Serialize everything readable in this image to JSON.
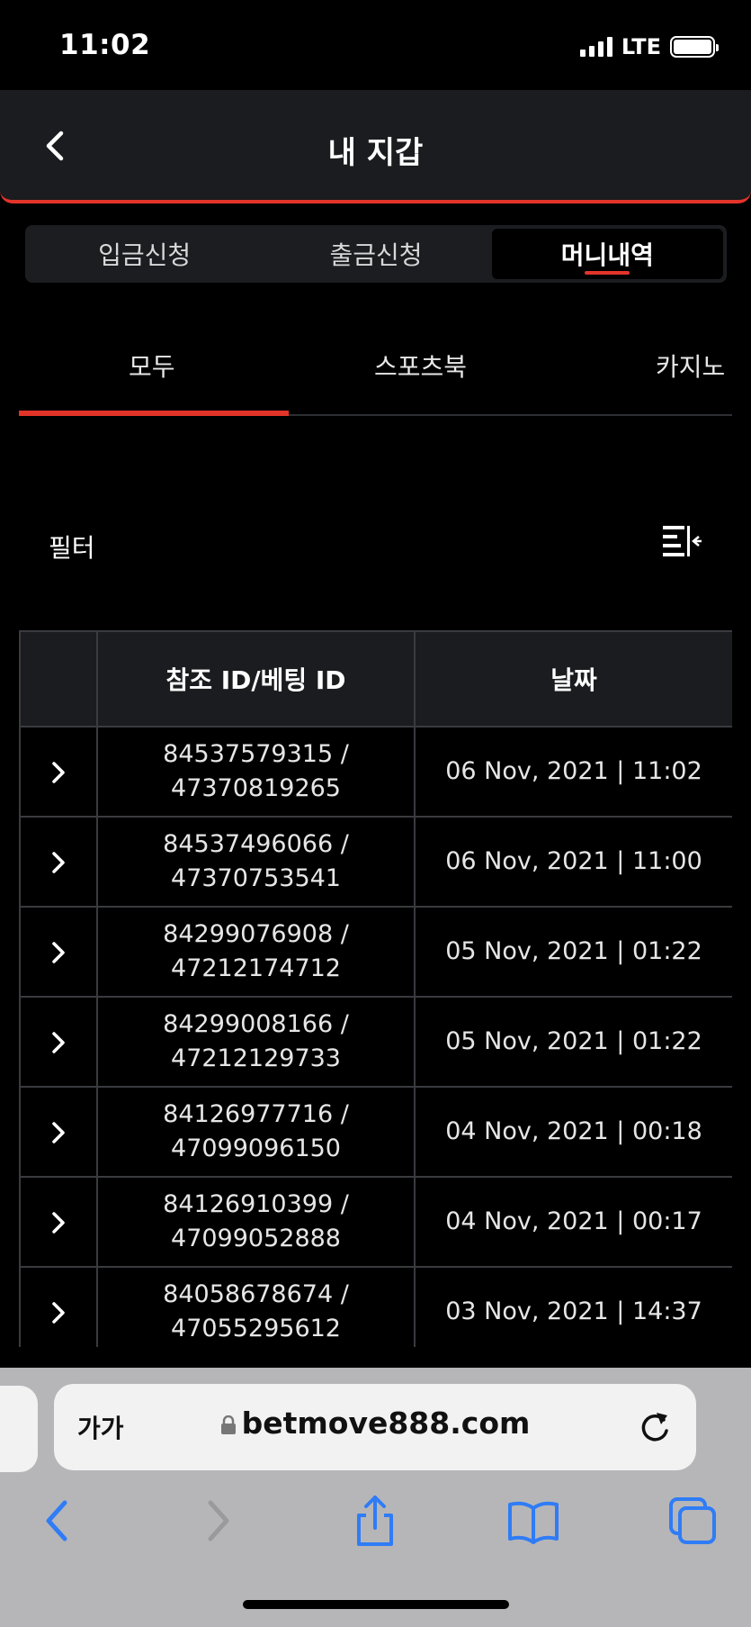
{
  "status_bar": {
    "time": "11:02",
    "network": "LTE"
  },
  "header": {
    "title": "내 지갑"
  },
  "segments": [
    {
      "label": "입금신청",
      "active": false
    },
    {
      "label": "출금신청",
      "active": false
    },
    {
      "label": "머니내역",
      "active": true
    }
  ],
  "categories": [
    {
      "label": "모두",
      "active": true
    },
    {
      "label": "스포츠북",
      "active": false
    },
    {
      "label": "카지노",
      "active": false
    }
  ],
  "filter": {
    "label": "필터"
  },
  "table": {
    "headers": [
      "",
      "참조 ID/베팅 ID",
      "날짜"
    ],
    "rows": [
      {
        "ref": "84537579315 /",
        "bet": "47370819265",
        "date": "06 Nov, 2021 | 11:02"
      },
      {
        "ref": "84537496066 /",
        "bet": "47370753541",
        "date": "06 Nov, 2021 | 11:00"
      },
      {
        "ref": "84299076908 /",
        "bet": "47212174712",
        "date": "05 Nov, 2021 | 01:22"
      },
      {
        "ref": "84299008166 /",
        "bet": "47212129733",
        "date": "05 Nov, 2021 | 01:22"
      },
      {
        "ref": "84126977716 /",
        "bet": "47099096150",
        "date": "04 Nov, 2021 | 00:18"
      },
      {
        "ref": "84126910399 /",
        "bet": "47099052888",
        "date": "04 Nov, 2021 | 00:17"
      },
      {
        "ref": "84058678674 /",
        "bet": "47055295612",
        "date": "03 Nov, 2021 | 14:37"
      }
    ]
  },
  "browser": {
    "text_size": "가가",
    "url": "betmove888.com"
  },
  "colors": {
    "accent": "#e3342a",
    "ios_blue": "#2f7cf6"
  }
}
